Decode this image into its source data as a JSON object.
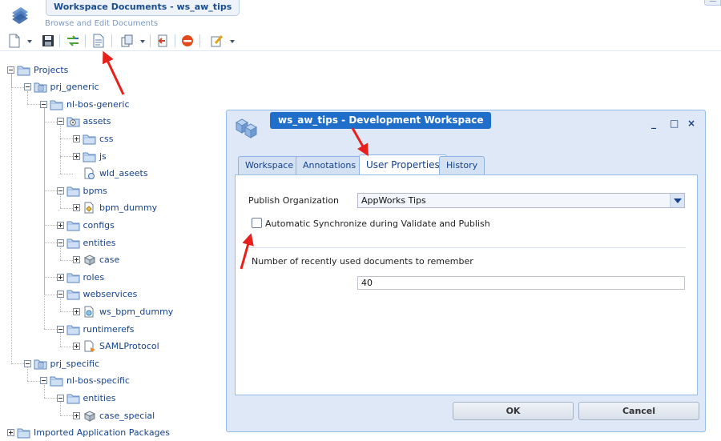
{
  "header": {
    "title": "Workspace Documents - ws_aw_tips",
    "subtitle": "Browse and Edit Documents"
  },
  "toolbar": {
    "buttons": [
      "new-document-icon",
      "dropdown-arrow-icon",
      "save-icon",
      "synchronize-icon",
      "document-properties-icon",
      "copy-icon",
      "dropdown-arrow-icon",
      "exit-icon",
      "stop-icon",
      "edit-icon",
      "dropdown-arrow-icon"
    ]
  },
  "tree": {
    "items": [
      {
        "label": "Projects",
        "icon": "folder-icon",
        "depth": 0,
        "state": "expanded"
      },
      {
        "label": "prj_generic",
        "icon": "project-icon",
        "depth": 1,
        "state": "expanded"
      },
      {
        "label": "nl-bos-generic",
        "icon": "folder-icon",
        "depth": 2,
        "state": "expanded"
      },
      {
        "label": "assets",
        "icon": "gear-folder-icon",
        "depth": 3,
        "state": "expanded"
      },
      {
        "label": "css",
        "icon": "folder-icon",
        "depth": 4,
        "state": "collapsed"
      },
      {
        "label": "js",
        "icon": "folder-icon",
        "depth": 4,
        "state": "collapsed"
      },
      {
        "label": "wld_aseets",
        "icon": "web-library-icon",
        "depth": 4,
        "state": "leaf"
      },
      {
        "label": "bpms",
        "icon": "folder-icon",
        "depth": 3,
        "state": "expanded"
      },
      {
        "label": "bpm_dummy",
        "icon": "bpm-icon",
        "depth": 4,
        "state": "collapsed"
      },
      {
        "label": "configs",
        "icon": "folder-icon",
        "depth": 3,
        "state": "collapsed"
      },
      {
        "label": "entities",
        "icon": "folder-icon",
        "depth": 3,
        "state": "expanded"
      },
      {
        "label": "case",
        "icon": "entity-icon",
        "depth": 4,
        "state": "collapsed"
      },
      {
        "label": "roles",
        "icon": "folder-icon",
        "depth": 3,
        "state": "collapsed"
      },
      {
        "label": "webservices",
        "icon": "folder-icon",
        "depth": 3,
        "state": "expanded"
      },
      {
        "label": "ws_bpm_dummy",
        "icon": "webservice-icon",
        "depth": 4,
        "state": "collapsed"
      },
      {
        "label": "runtimerefs",
        "icon": "folder-icon",
        "depth": 3,
        "state": "expanded"
      },
      {
        "label": "SAMLProtocol",
        "icon": "runtime-reference-icon",
        "depth": 4,
        "state": "collapsed"
      },
      {
        "label": "prj_specific",
        "icon": "project-icon",
        "depth": 1,
        "state": "expanded"
      },
      {
        "label": "nl-bos-specific",
        "icon": "folder-icon",
        "depth": 2,
        "state": "expanded"
      },
      {
        "label": "entities",
        "icon": "folder-icon",
        "depth": 3,
        "state": "expanded"
      },
      {
        "label": "case_special",
        "icon": "entity-icon",
        "depth": 4,
        "state": "collapsed"
      },
      {
        "label": "Imported Application Packages",
        "icon": "folder-icon",
        "depth": 0,
        "state": "collapsed"
      }
    ]
  },
  "dialog": {
    "title": "ws_aw_tips - Development Workspace",
    "tools": [
      "_",
      "□",
      "×"
    ],
    "tabs": [
      "Workspace",
      "Annotations",
      "User Properties",
      "History"
    ],
    "active_tab": "User Properties",
    "publish_org_label": "Publish Organization",
    "publish_org_value": "AppWorks Tips",
    "auto_sync_label": "Automatic Synchronize during Validate and Publish",
    "auto_sync_checked": false,
    "recent_docs_label": "Number of recently used documents to remember",
    "recent_docs_value": "40",
    "ok_label": "OK",
    "cancel_label": "Cancel"
  },
  "colors": {
    "title_bar": "#1f6ec9",
    "tree_text": "#15428b",
    "annotation_arrow": "#e8201b"
  }
}
